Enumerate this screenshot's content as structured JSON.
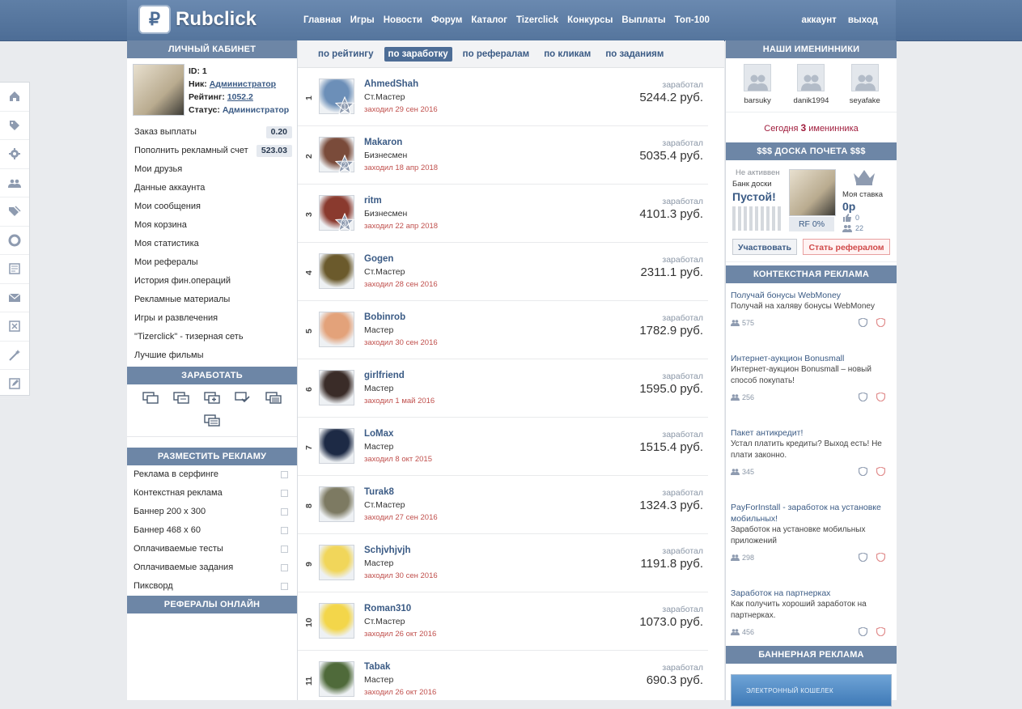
{
  "header": {
    "logo_text": "Rubclick",
    "logo_mark": "₽",
    "nav": [
      "Главная",
      "Игры",
      "Новости",
      "Форум",
      "Каталог",
      "Tizerclick",
      "Конкурсы",
      "Выплаты",
      "Топ-100"
    ],
    "account": "аккаунт",
    "logout": "выход"
  },
  "rail": {
    "icons": [
      "home-icon",
      "tag-icon",
      "gear-icon",
      "users-icon",
      "tags-icon",
      "lifebuoy-icon",
      "news-icon",
      "mail-icon",
      "close-box-icon",
      "magic-icon",
      "edit-icon"
    ]
  },
  "left": {
    "cabinet_title": "ЛИЧНЫЙ КАБИНЕТ",
    "profile": {
      "id_label": "ID:",
      "id_value": "1",
      "nick_label": "Ник:",
      "nick_value": "Администратор",
      "rating_label": "Рейтинг:",
      "rating_value": "1052.2",
      "status_label": "Статус:",
      "status_value": "Администратор"
    },
    "menu": [
      {
        "label": "Заказ выплаты",
        "badge": "0.20"
      },
      {
        "label": "Пополнить рекламный счет",
        "badge": "523.03"
      },
      {
        "label": "Мои друзья"
      },
      {
        "label": "Данные аккаунта"
      },
      {
        "label": "Мои сообщения"
      },
      {
        "label": "Моя корзина"
      },
      {
        "label": "Моя статистика"
      },
      {
        "label": "Мои рефералы"
      },
      {
        "label": "История фин.операций"
      },
      {
        "label": "Рекламные материалы"
      },
      {
        "label": "Игры и развлечения"
      },
      {
        "label": "\"Tizerclick\" - тизерная сеть"
      },
      {
        "label": "Лучшие фильмы"
      }
    ],
    "earn_title": "ЗАРАБОТАТЬ",
    "ads_title": "РАЗМЕСТИТЬ РЕКЛАМУ",
    "ads_menu": [
      "Реклама в серфинге",
      "Контекстная реклама",
      "Баннер 200 х 300",
      "Баннер 468 х 60",
      "Оплачиваемые тесты",
      "Оплачиваемые задания",
      "Пиксворд"
    ],
    "referrals_title": "РЕФЕРАЛЫ ОНЛАЙН"
  },
  "main": {
    "tabs": [
      {
        "label": "по рейтингу",
        "active": false
      },
      {
        "label": "по заработку",
        "active": true
      },
      {
        "label": "по рефералам",
        "active": false
      },
      {
        "label": "по кликам",
        "active": false
      },
      {
        "label": "по заданиям",
        "active": false
      }
    ],
    "earned_label": "заработал",
    "rows": [
      {
        "rank": "1",
        "name": "AhmedShah",
        "status": "Ст.Мастер",
        "seen": "заходил 29 сен 2016",
        "amount": "5244.2 руб.",
        "star": "1",
        "color": "#6c8fb8"
      },
      {
        "rank": "2",
        "name": "Makaron",
        "status": "Бизнесмен",
        "seen": "заходил 18 апр 2018",
        "amount": "5035.4 руб.",
        "star": "2",
        "color": "#7a4b3a"
      },
      {
        "rank": "3",
        "name": "ritm",
        "status": "Бизнесмен",
        "seen": "заходил 22 апр 2018",
        "amount": "4101.3 руб.",
        "star": "3",
        "color": "#8a3a2e"
      },
      {
        "rank": "4",
        "name": "Gogen",
        "status": "Ст.Мастер",
        "seen": "заходил 28 сен 2016",
        "amount": "2311.1 руб.",
        "star": "",
        "color": "#6b5a2c"
      },
      {
        "rank": "5",
        "name": "Bobinrob",
        "status": "Мастер",
        "seen": "заходил 30 сен 2016",
        "amount": "1782.9 руб.",
        "star": "",
        "color": "#e3a27a"
      },
      {
        "rank": "6",
        "name": "girlfriend",
        "status": "Мастер",
        "seen": "заходил 1 май 2016",
        "amount": "1595.0 руб.",
        "star": "",
        "color": "#3a2c28"
      },
      {
        "rank": "7",
        "name": "LoMax",
        "status": "Мастер",
        "seen": "заходил 8 окт 2015",
        "amount": "1515.4 руб.",
        "star": "",
        "color": "#1d2a45"
      },
      {
        "rank": "8",
        "name": "Turak8",
        "status": "Ст.Мастер",
        "seen": "заходил 27 сен 2016",
        "amount": "1324.3 руб.",
        "star": "",
        "color": "#7d7a62"
      },
      {
        "rank": "9",
        "name": "Schjvhjvjh",
        "status": "Мастер",
        "seen": "заходил 30 сен 2016",
        "amount": "1191.8 руб.",
        "star": "",
        "color": "#f1d65a"
      },
      {
        "rank": "10",
        "name": "Roman310",
        "status": "Ст.Мастер",
        "seen": "заходил 26 окт 2016",
        "amount": "1073.0 руб.",
        "star": "",
        "color": "#f3d64a"
      },
      {
        "rank": "11",
        "name": "Tabak",
        "status": "Мастер",
        "seen": "заходил 26 окт 2016",
        "amount": "690.3 руб.",
        "star": "",
        "color": "#4f6a3a"
      }
    ]
  },
  "right": {
    "bday_title": "НАШИ ИМЕНИННИКИ",
    "bdays": [
      "barsuky",
      "danik1994",
      "seyafake"
    ],
    "bday_note_pre": "Сегодня",
    "bday_note_num": "3",
    "bday_note_post": "именинника",
    "honor_title": "$$$ ДОСКА ПОЧЕТА $$$",
    "honor": {
      "inactive": "Не активвен",
      "bank": "Банк доски",
      "empty": "Пустой!",
      "rf": "RF 0%",
      "stake_label": "Моя ставка",
      "stake_value": "0р",
      "likes": "0",
      "refs": "22",
      "btn_participate": "Участвовать",
      "btn_referral": "Стать рефералом"
    },
    "ctx_title": "КОНТЕКСТНАЯ РЕКЛАМА",
    "ctx": [
      {
        "title": "Получай бонусы WebMoney",
        "desc": "Получай на халяву бонусы WebMoney",
        "count": "575"
      },
      {
        "title": "Интернет-аукцион Bonusmall",
        "desc": "Интернет-аукцион Bonusmall – новый способ покупать!",
        "count": "256"
      },
      {
        "title": "Пакет антикредит!",
        "desc": "Устал платить кредиты? Выход есть! Не плати законно.",
        "count": "345"
      },
      {
        "title": "PayForInstall - заработок на установке мобильных!",
        "desc": "Заработок на установке мобильных приложений",
        "count": "298"
      },
      {
        "title": "Заработок на партнерках",
        "desc": "Как получить хороший заработок на партнерках.",
        "count": "456"
      }
    ],
    "banner_title": "БАННЕРНАЯ РЕКЛАМА",
    "banner_text": "ЭЛЕКТРОННЫЙ КОШЕЛЕК"
  },
  "colors": {
    "accent": "#4d6d96",
    "section": "#6d86a6",
    "link": "#3b5b85",
    "seen": "#c0504d",
    "bday": "#a01c3c"
  }
}
